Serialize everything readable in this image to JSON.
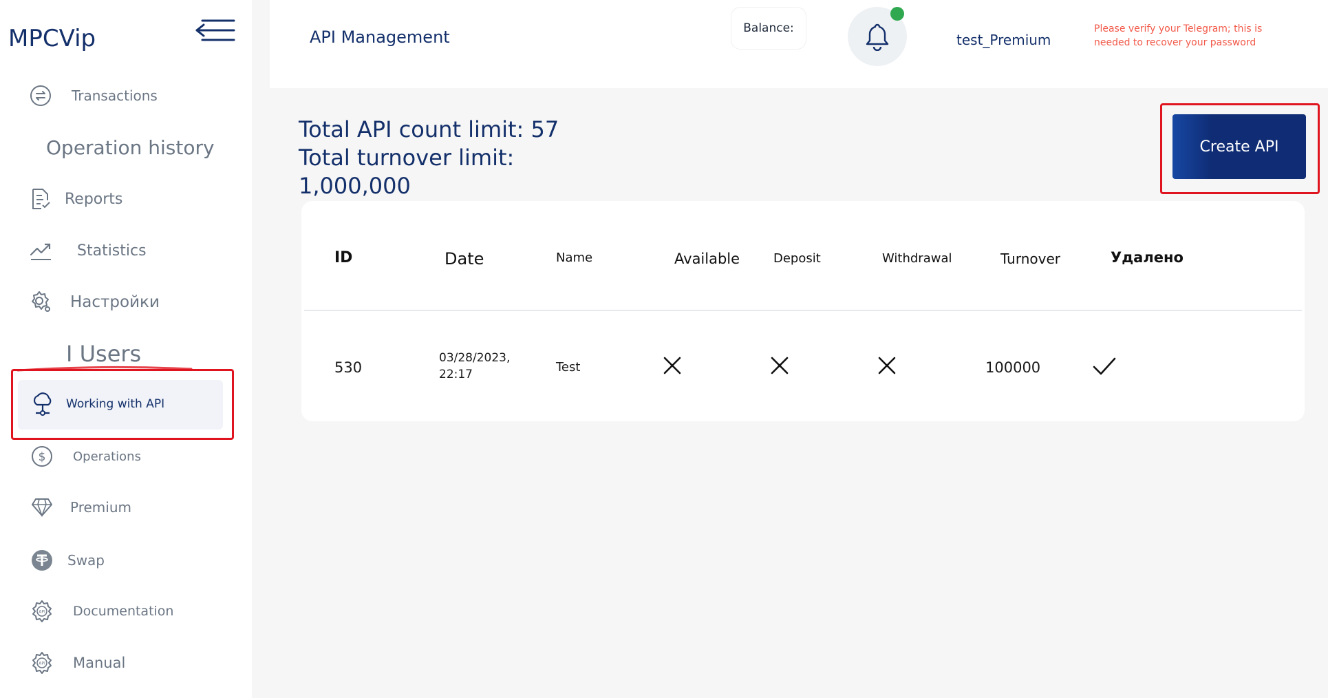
{
  "sidebar": {
    "logo": "MPCVip",
    "items": {
      "transactions": "Transactions",
      "operation_history": "Operation history",
      "reports": "Reports",
      "statistics": "Statistics",
      "settings": "Настройки",
      "users": "I Users",
      "working_with_api": "Working with API",
      "operations": "Operations",
      "premium": "Premium",
      "swap": "Swap",
      "documentation": "Documentation",
      "manual": "Manual"
    }
  },
  "header": {
    "title": "API Management",
    "balance_label": "Balance:",
    "username": "test_Premium",
    "telegram_warning": "Please verify your Telegram; this is needed to recover your password"
  },
  "main": {
    "limits_text": "Total API count limit: 57 Total turnover limit: 1,000,000",
    "create_button": "Create API",
    "table": {
      "headers": {
        "id": "ID",
        "date": "Date",
        "name": "Name",
        "available": "Available",
        "deposit": "Deposit",
        "withdrawal": "Withdrawal",
        "turnover": "Turnover",
        "deleted": "Удалено"
      },
      "rows": [
        {
          "id": "530",
          "date_line1": "03/28/2023,",
          "date_line2": "22:17",
          "name": "Test",
          "available": false,
          "deposit": false,
          "withdrawal": false,
          "turnover": "100000",
          "deleted": true
        }
      ]
    }
  },
  "colors": {
    "brand": "#14306b",
    "button": "#0f2c74",
    "warning": "#f25a4a",
    "highlight": "#e0141e",
    "online": "#2fa84f"
  },
  "icons": [
    "menu-icon",
    "transactions-icon",
    "reports-icon",
    "statistics-icon",
    "settings-icon",
    "api-icon",
    "operations-icon",
    "premium-icon",
    "swap-icon",
    "documentation-icon",
    "manual-icon",
    "bell-icon",
    "cross-icon",
    "check-icon"
  ]
}
